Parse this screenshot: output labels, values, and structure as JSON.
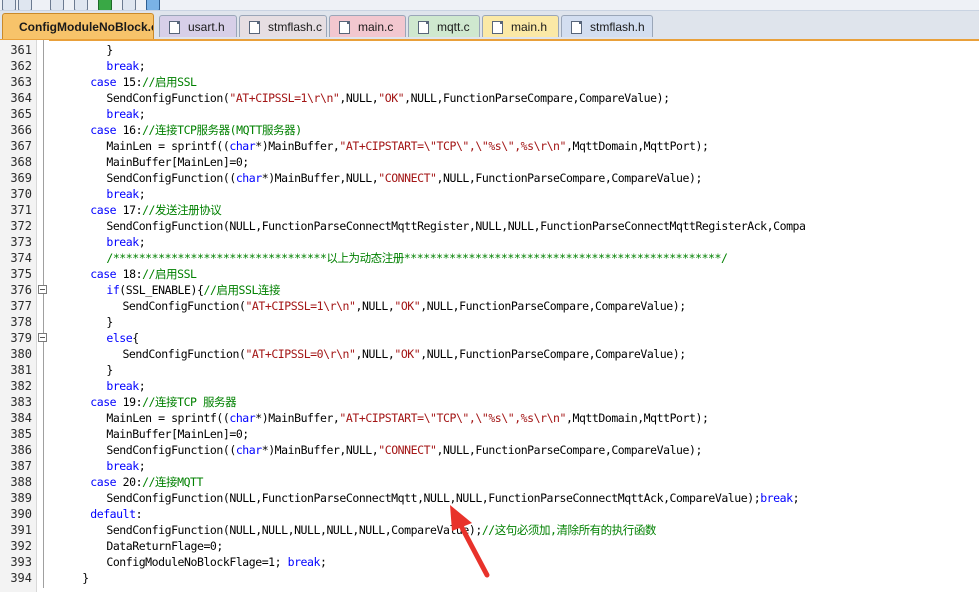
{
  "editor": {
    "tabs": [
      {
        "label": "ConfigModuleNoBlock.c",
        "color": "#f7c36a",
        "active": true
      },
      {
        "label": "usart.h",
        "color": "#d7cfe8",
        "active": false
      },
      {
        "label": "stmflash.c",
        "color": "#e6dee2",
        "active": false
      },
      {
        "label": "main.c",
        "color": "#f2c7cf",
        "active": false
      },
      {
        "label": "mqtt.c",
        "color": "#cfe8cf",
        "active": false
      },
      {
        "label": "main.h",
        "color": "#fbe9a6",
        "active": false
      },
      {
        "label": "stmflash.h",
        "color": "#d3def0",
        "active": false
      }
    ],
    "lines": [
      {
        "no": "361",
        "indent": 7,
        "tokens": [
          {
            "t": "}",
            "c": "p"
          }
        ]
      },
      {
        "no": "362",
        "indent": 7,
        "tokens": [
          {
            "t": "break",
            "c": "kw"
          },
          {
            "t": ";",
            "c": "p"
          }
        ]
      },
      {
        "no": "363",
        "indent": 5,
        "tokens": [
          {
            "t": "case",
            "c": "kw"
          },
          {
            "t": " 15:",
            "c": "p"
          },
          {
            "t": "//启用SSL",
            "c": "cmt"
          }
        ]
      },
      {
        "no": "364",
        "indent": 7,
        "tokens": [
          {
            "t": "SendConfigFunction(",
            "c": "p"
          },
          {
            "t": "\"AT+CIPSSL=1\\r\\n\"",
            "c": "str"
          },
          {
            "t": ",NULL,",
            "c": "p"
          },
          {
            "t": "\"OK\"",
            "c": "str"
          },
          {
            "t": ",NULL,FunctionParseCompare,CompareValue);",
            "c": "p"
          }
        ]
      },
      {
        "no": "365",
        "indent": 7,
        "tokens": [
          {
            "t": "break",
            "c": "kw"
          },
          {
            "t": ";",
            "c": "p"
          }
        ]
      },
      {
        "no": "366",
        "indent": 5,
        "tokens": [
          {
            "t": "case",
            "c": "kw"
          },
          {
            "t": " 16:",
            "c": "p"
          },
          {
            "t": "//连接TCP服务器(MQTT服务器)",
            "c": "cmt"
          }
        ]
      },
      {
        "no": "367",
        "indent": 7,
        "tokens": [
          {
            "t": "MainLen = sprintf((",
            "c": "p"
          },
          {
            "t": "char",
            "c": "kw"
          },
          {
            "t": "*)MainBuffer,",
            "c": "p"
          },
          {
            "t": "\"AT+CIPSTART=\\\"TCP\\\",\\\"%s\\\",%s\\r\\n\"",
            "c": "str"
          },
          {
            "t": ",MqttDomain,MqttPort);",
            "c": "p"
          }
        ]
      },
      {
        "no": "368",
        "indent": 7,
        "tokens": [
          {
            "t": "MainBuffer[MainLen]=0;",
            "c": "p"
          }
        ]
      },
      {
        "no": "369",
        "indent": 7,
        "tokens": [
          {
            "t": "SendConfigFunction((",
            "c": "p"
          },
          {
            "t": "char",
            "c": "kw"
          },
          {
            "t": "*)MainBuffer,NULL,",
            "c": "p"
          },
          {
            "t": "\"CONNECT\"",
            "c": "str"
          },
          {
            "t": ",NULL,FunctionParseCompare,CompareValue);",
            "c": "p"
          }
        ]
      },
      {
        "no": "370",
        "indent": 7,
        "tokens": [
          {
            "t": "break",
            "c": "kw"
          },
          {
            "t": ";",
            "c": "p"
          }
        ]
      },
      {
        "no": "371",
        "indent": 5,
        "tokens": [
          {
            "t": "case",
            "c": "kw"
          },
          {
            "t": " 17:",
            "c": "p"
          },
          {
            "t": "//发送注册协议",
            "c": "cmt"
          }
        ]
      },
      {
        "no": "372",
        "indent": 7,
        "tokens": [
          {
            "t": "SendConfigFunction(NULL,FunctionParseConnectMqttRegister,NULL,NULL,FunctionParseConnectMqttRegisterAck,Compa",
            "c": "p"
          }
        ]
      },
      {
        "no": "373",
        "indent": 7,
        "tokens": [
          {
            "t": "break",
            "c": "kw"
          },
          {
            "t": ";",
            "c": "p"
          }
        ]
      },
      {
        "no": "374",
        "indent": 7,
        "tokens": [
          {
            "t": "/*********************************以上为动态注册*************************************************/",
            "c": "cmt"
          }
        ]
      },
      {
        "no": "375",
        "indent": 5,
        "tokens": [
          {
            "t": "case",
            "c": "kw"
          },
          {
            "t": " 18:",
            "c": "p"
          },
          {
            "t": "//启用SSL",
            "c": "cmt"
          }
        ]
      },
      {
        "no": "376",
        "indent": 7,
        "tokens": [
          {
            "t": "if",
            "c": "kw"
          },
          {
            "t": "(SSL_ENABLE){",
            "c": "p"
          },
          {
            "t": "//启用SSL连接",
            "c": "cmt"
          }
        ]
      },
      {
        "no": "377",
        "indent": 9,
        "tokens": [
          {
            "t": "SendConfigFunction(",
            "c": "p"
          },
          {
            "t": "\"AT+CIPSSL=1\\r\\n\"",
            "c": "str"
          },
          {
            "t": ",NULL,",
            "c": "p"
          },
          {
            "t": "\"OK\"",
            "c": "str"
          },
          {
            "t": ",NULL,FunctionParseCompare,CompareValue);",
            "c": "p"
          }
        ]
      },
      {
        "no": "378",
        "indent": 7,
        "tokens": [
          {
            "t": "}",
            "c": "p"
          }
        ]
      },
      {
        "no": "379",
        "indent": 7,
        "tokens": [
          {
            "t": "else",
            "c": "kw"
          },
          {
            "t": "{",
            "c": "p"
          }
        ]
      },
      {
        "no": "380",
        "indent": 9,
        "tokens": [
          {
            "t": "SendConfigFunction(",
            "c": "p"
          },
          {
            "t": "\"AT+CIPSSL=0\\r\\n\"",
            "c": "str"
          },
          {
            "t": ",NULL,",
            "c": "p"
          },
          {
            "t": "\"OK\"",
            "c": "str"
          },
          {
            "t": ",NULL,FunctionParseCompare,CompareValue);",
            "c": "p"
          }
        ]
      },
      {
        "no": "381",
        "indent": 7,
        "tokens": [
          {
            "t": "}",
            "c": "p"
          }
        ]
      },
      {
        "no": "382",
        "indent": 7,
        "tokens": [
          {
            "t": "break",
            "c": "kw"
          },
          {
            "t": ";",
            "c": "p"
          }
        ]
      },
      {
        "no": "383",
        "indent": 5,
        "tokens": [
          {
            "t": "case",
            "c": "kw"
          },
          {
            "t": " 19:",
            "c": "p"
          },
          {
            "t": "//连接TCP 服务器",
            "c": "cmt"
          }
        ]
      },
      {
        "no": "384",
        "indent": 7,
        "tokens": [
          {
            "t": "MainLen = sprintf((",
            "c": "p"
          },
          {
            "t": "char",
            "c": "kw"
          },
          {
            "t": "*)MainBuffer,",
            "c": "p"
          },
          {
            "t": "\"AT+CIPSTART=\\\"TCP\\\",\\\"%s\\\",%s\\r\\n\"",
            "c": "str"
          },
          {
            "t": ",MqttDomain,MqttPort);",
            "c": "p"
          }
        ]
      },
      {
        "no": "385",
        "indent": 7,
        "tokens": [
          {
            "t": "MainBuffer[MainLen]=0;",
            "c": "p"
          }
        ]
      },
      {
        "no": "386",
        "indent": 7,
        "tokens": [
          {
            "t": "SendConfigFunction((",
            "c": "p"
          },
          {
            "t": "char",
            "c": "kw"
          },
          {
            "t": "*)MainBuffer,NULL,",
            "c": "p"
          },
          {
            "t": "\"CONNECT\"",
            "c": "str"
          },
          {
            "t": ",NULL,FunctionParseCompare,CompareValue);",
            "c": "p"
          }
        ]
      },
      {
        "no": "387",
        "indent": 7,
        "tokens": [
          {
            "t": "break",
            "c": "kw"
          },
          {
            "t": ";",
            "c": "p"
          }
        ]
      },
      {
        "no": "388",
        "indent": 5,
        "tokens": [
          {
            "t": "case",
            "c": "kw"
          },
          {
            "t": " 20:",
            "c": "p"
          },
          {
            "t": "//连接MQTT",
            "c": "cmt"
          }
        ]
      },
      {
        "no": "389",
        "indent": 7,
        "tokens": [
          {
            "t": "SendConfigFunction(NULL,FunctionParseConnectMqtt,NULL,NULL,FunctionParseConnectMqttAck,CompareValue);",
            "c": "p"
          },
          {
            "t": "break",
            "c": "kw"
          },
          {
            "t": ";",
            "c": "p"
          }
        ]
      },
      {
        "no": "390",
        "indent": 5,
        "tokens": [
          {
            "t": "default",
            "c": "kw"
          },
          {
            "t": ":",
            "c": "p"
          }
        ]
      },
      {
        "no": "391",
        "indent": 7,
        "tokens": [
          {
            "t": "SendConfigFunction(NULL,NULL,NULL,NULL,NULL,CompareValue);",
            "c": "p"
          },
          {
            "t": "//这句必须加,清除所有的执行函数",
            "c": "cmt"
          }
        ]
      },
      {
        "no": "392",
        "indent": 7,
        "tokens": [
          {
            "t": "DataReturnFlage=0;",
            "c": "p"
          }
        ]
      },
      {
        "no": "393",
        "indent": 7,
        "tokens": [
          {
            "t": "ConfigModuleNoBlockFlage=1; ",
            "c": "p"
          },
          {
            "t": "break",
            "c": "kw"
          },
          {
            "t": ";",
            "c": "p"
          }
        ]
      },
      {
        "no": "394",
        "indent": 4,
        "tokens": [
          {
            "t": "}",
            "c": "p"
          }
        ]
      }
    ],
    "fold_markers": [
      "376",
      "379"
    ],
    "annotation": {
      "shape": "red-arrow",
      "color": "#e8322b"
    }
  }
}
